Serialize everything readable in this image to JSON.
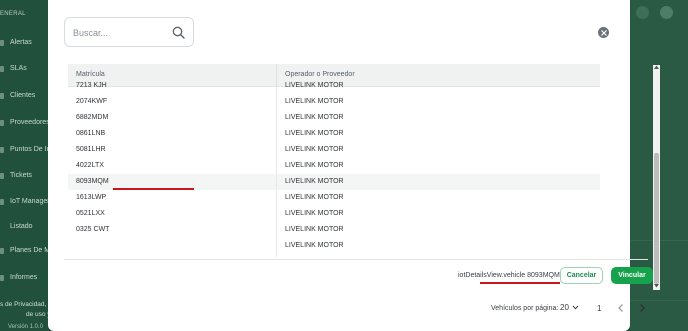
{
  "background": {
    "sidebar": {
      "section_label": "ENERAL",
      "items": [
        {
          "label": "Alertas"
        },
        {
          "label": "SLAs"
        },
        {
          "label": "Clientes"
        },
        {
          "label": "Proveedores"
        },
        {
          "label": "Puntos De Int"
        },
        {
          "label": "Tickets"
        },
        {
          "label": "IoT Managem"
        },
        {
          "label": "Listado"
        },
        {
          "label": "Planes De Mi"
        },
        {
          "label": "Informes"
        }
      ]
    },
    "footer": {
      "line1": "s de Privacidad, ",
      "line2": "de uso y A",
      "line3": "Versión 1.0.0"
    }
  },
  "modal": {
    "search": {
      "placeholder": "Buscar...",
      "value": ""
    },
    "table": {
      "columns": [
        "Matrícula",
        "Operador o Proveedor"
      ],
      "partial_top_row": {
        "plate": "7213 KJH",
        "operator": "LIVELINK MOTOR"
      },
      "rows": [
        {
          "plate": "2074KWF",
          "operator": "LIVELINK MOTOR"
        },
        {
          "plate": "6882MDM",
          "operator": "LIVELINK MOTOR"
        },
        {
          "plate": "0861LNB",
          "operator": "LIVELINK MOTOR"
        },
        {
          "plate": "5081LHR",
          "operator": "LIVELINK MOTOR"
        },
        {
          "plate": "4022LTX",
          "operator": "LIVELINK MOTOR"
        },
        {
          "plate": "8093MQM",
          "operator": "LIVELINK MOTOR",
          "highlighted": true
        },
        {
          "plate": "1613LWP",
          "operator": "LIVELINK MOTOR"
        },
        {
          "plate": "0521LXX",
          "operator": "LIVELINK MOTOR"
        },
        {
          "plate": "0325 CWT",
          "operator": "LIVELINK MOTOR"
        },
        {
          "plate": "",
          "operator": "LIVELINK MOTOR"
        }
      ]
    },
    "selected_text": "iotDetailsView.vehicle 8093MQM",
    "buttons": {
      "cancel": "Cancelar",
      "link": "Vincular"
    },
    "pagination": {
      "label": "Vehículos por página:",
      "page_size": "20",
      "current_page": "1"
    }
  },
  "colors": {
    "accent_green": "#16a24c",
    "highlight_red": "#c6191f",
    "sidebar_bg": "#21503c"
  }
}
